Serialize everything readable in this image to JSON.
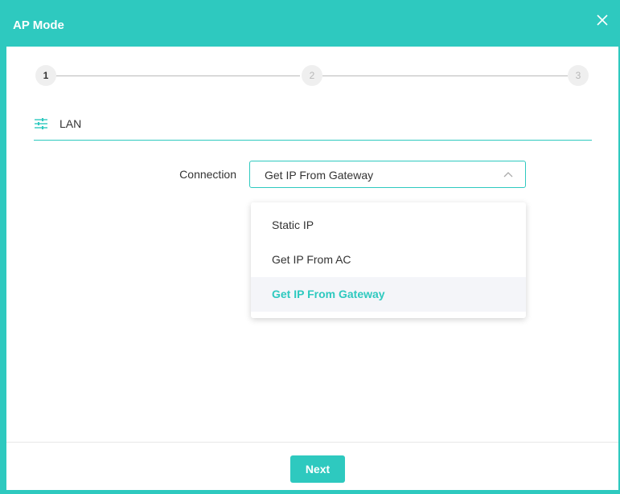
{
  "dialog": {
    "title": "AP Mode",
    "close_icon": "close-icon"
  },
  "stepper": {
    "current": 1,
    "steps": [
      "1",
      "2",
      "3"
    ]
  },
  "section": {
    "icon": "sliders-icon",
    "label": "LAN"
  },
  "connection": {
    "label": "Connection",
    "selected": "Get IP From Gateway",
    "chevron_icon": "chevron-up-icon",
    "options": [
      "Static IP",
      "Get IP From AC",
      "Get IP From Gateway"
    ]
  },
  "footer": {
    "next_label": "Next"
  },
  "colors": {
    "accent": "#2ec9bf",
    "text": "#333333",
    "selected_option_bg": "#f4f5f9"
  }
}
